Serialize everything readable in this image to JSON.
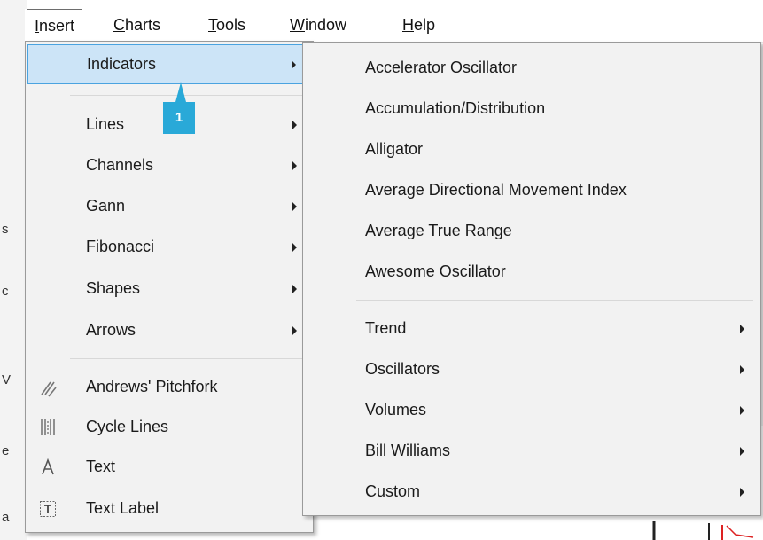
{
  "menubar": {
    "items": [
      {
        "label": "Insert",
        "accel": "I"
      },
      {
        "label": "Charts",
        "accel": "C"
      },
      {
        "label": "Tools",
        "accel": "T"
      },
      {
        "label": "Window",
        "accel": "W"
      },
      {
        "label": "Help",
        "accel": "H"
      }
    ],
    "insert": {
      "pre": "",
      "accel": "I",
      "post": "nsert"
    },
    "charts": {
      "pre": "",
      "accel": "C",
      "post": "harts"
    },
    "tools": {
      "pre": "",
      "accel": "T",
      "post": "ools"
    },
    "window": {
      "pre": "",
      "accel": "W",
      "post": "indow"
    },
    "help": {
      "pre": "",
      "accel": "H",
      "post": "elp"
    }
  },
  "insert_menu": {
    "indicators": "Indicators",
    "lines": "Lines",
    "channels": "Channels",
    "gann": "Gann",
    "fibonacci": "Fibonacci",
    "shapes": "Shapes",
    "arrows": "Arrows",
    "andrews_pitchfork": "Andrews' Pitchfork",
    "cycle_lines": "Cycle Lines",
    "text": "Text",
    "text_label": "Text Label",
    "icons": {
      "pitchfork": "pitchfork-icon",
      "cycle_lines": "cycle-lines-icon",
      "text": "text-icon",
      "text_label": "text-label-icon"
    }
  },
  "callout": {
    "number": "1",
    "color": "#29a9d8"
  },
  "indicators_submenu": {
    "items": [
      "Accelerator Oscillator",
      "Accumulation/Distribution",
      "Alligator",
      "Average Directional Movement Index",
      "Average True Range",
      "Awesome Oscillator"
    ],
    "groups": [
      "Trend",
      "Oscillators",
      "Volumes",
      "Bill Williams",
      "Custom"
    ]
  },
  "colors": {
    "highlight": "#cce4f7",
    "highlight_border": "#4aa3e0",
    "menu_bg": "#f2f2f2"
  }
}
